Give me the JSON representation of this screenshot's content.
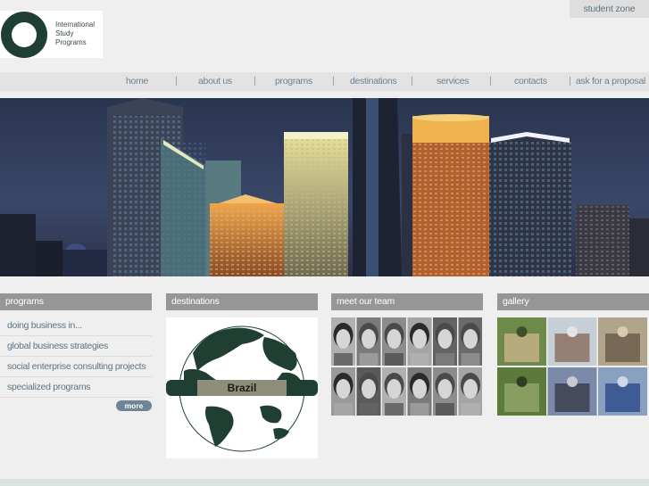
{
  "logo": {
    "lines": [
      "International",
      "Study",
      "Programs"
    ],
    "icon": "ring-logo"
  },
  "header": {
    "student_zone": "student zone"
  },
  "nav": {
    "items": [
      "home",
      "about us",
      "programs",
      "destinations",
      "services",
      "contacts",
      "ask for a proposal"
    ]
  },
  "panels": {
    "programs": {
      "title": "programs",
      "items": [
        "doing business in...",
        "global business strategies",
        "social enterprise consulting projects",
        "specialized programs"
      ],
      "more": "more"
    },
    "destinations": {
      "title": "destinations",
      "label": "Brazil"
    },
    "team": {
      "title": "meet our team"
    },
    "gallery": {
      "title": "gallery"
    }
  },
  "colors": {
    "brand": "#1f3f33",
    "link": "#5d7585",
    "panel_head": "#969696",
    "more_button": "#6f8495"
  }
}
